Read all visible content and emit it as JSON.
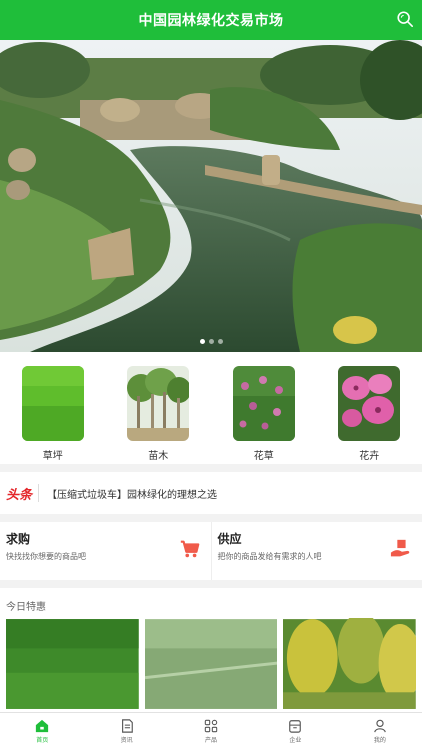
{
  "header": {
    "title": "中国园林绿化交易市场",
    "search_icon": "search-icon"
  },
  "banner": {
    "slide_count": 3,
    "active_slide": 1
  },
  "categories": [
    {
      "label": "草坪",
      "icon": "lawn-image"
    },
    {
      "label": "苗木",
      "icon": "seedling-image"
    },
    {
      "label": "花草",
      "icon": "flower-grass-image"
    },
    {
      "label": "花卉",
      "icon": "flower-image"
    }
  ],
  "ticker": {
    "badge": "头条",
    "text": "【压缩式垃圾车】园林绿化的理想之选"
  },
  "demand": {
    "title": "求购",
    "subtitle": "快找找你想要的商品吧",
    "icon": "cart-icon"
  },
  "supply": {
    "title": "供应",
    "subtitle": "把你的商品发给有需求的人吧",
    "icon": "hand-box-icon"
  },
  "today": {
    "title": "今日特惠"
  },
  "tabbar": [
    {
      "label": "首页",
      "icon": "home-icon",
      "active": true
    },
    {
      "label": "资讯",
      "icon": "news-icon",
      "active": false
    },
    {
      "label": "产品",
      "icon": "grid-icon",
      "active": false
    },
    {
      "label": "企业",
      "icon": "company-icon",
      "active": false
    },
    {
      "label": "我的",
      "icon": "user-icon",
      "active": false
    }
  ],
  "colors": {
    "brand_green": "#1fbe3a",
    "headline_red": "#e4272b",
    "icon_red": "#f05a4a"
  }
}
